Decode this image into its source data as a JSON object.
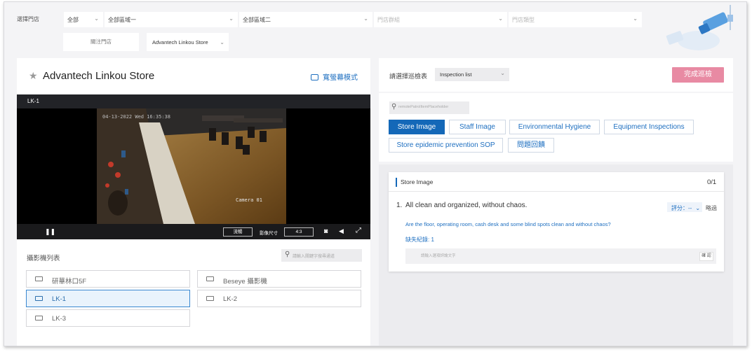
{
  "filters": {
    "label": "選擇門店",
    "all": "全部",
    "region1": "全部區域一",
    "region2": "全部區域二",
    "store_group": "門店群組",
    "store_type": "門店類型"
  },
  "store_bar": {
    "follow_button": "關注門店",
    "store_select": "Advantech Linkou Store"
  },
  "left_card": {
    "title": "Advantech Linkou Store",
    "wide_mode": "寬螢幕模式",
    "video": {
      "camera_name": "LK-1",
      "timestamp_overlay": "04-13-2022 Wed 16:35:38",
      "camera_overlay": "Camera 01",
      "quality_btn": "流暢",
      "size_label": "影像尺寸",
      "ratio": "4:3"
    },
    "camera_list_title": "攝影機列表",
    "search_placeholder": "請輸入關鍵字搜尋通道",
    "cameras": [
      {
        "label": "研華林口5F",
        "active": false
      },
      {
        "label": "Beseye 攝影機",
        "active": false
      },
      {
        "label": "LK-1",
        "active": true
      },
      {
        "label": "LK-2",
        "active": false
      },
      {
        "label": "LK-3",
        "active": false
      }
    ]
  },
  "right_card": {
    "select_label": "請選擇巡檢表",
    "inspection_select": "Inspection list",
    "complete_button": "完成巡檢",
    "search_placeholder": "remotePatrolItemPlaceholder",
    "tags": [
      {
        "label": "Store Image",
        "active": true
      },
      {
        "label": "Staff Image",
        "active": false
      },
      {
        "label": "Environmental Hygiene",
        "active": false
      },
      {
        "label": "Equipment Inspections",
        "active": false
      },
      {
        "label": "Store epidemic prevention SOP",
        "active": false
      },
      {
        "label": "問題回饋",
        "active": false
      }
    ],
    "section": {
      "title": "Store Image",
      "count": "0/1",
      "item_number": "1.",
      "item_title": "All clean and organized, without chaos.",
      "score_label": "評分：--",
      "skip_label": "略過",
      "item_desc": "Are the floor, operating room, cash desk and some blind spots clean and without chaos?",
      "missing_record": "缺失紀錄: 1",
      "comment_placeholder": "請輸入選項評論文字",
      "save_button": "確 認"
    }
  },
  "colors": {
    "accent": "#1468b8",
    "complete": "#e88aa3",
    "background": "#f4f4f6"
  }
}
